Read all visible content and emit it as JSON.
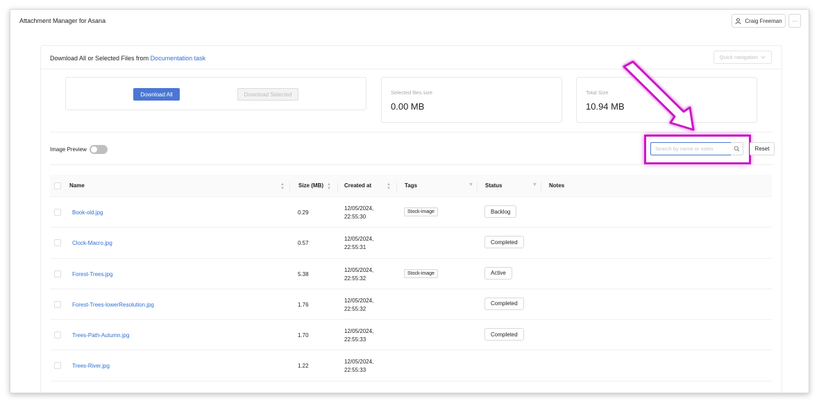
{
  "app": {
    "title": "Attachment Manager for Asana",
    "user_name": "Craig Freeman",
    "more_label": "···"
  },
  "card": {
    "title_prefix": "Download All or Selected Files from ",
    "task_link": "Documentation task",
    "quick_nav_label": "Quick navigation"
  },
  "downloads": {
    "download_all_label": "Download All",
    "download_selected_label": "Download Selected"
  },
  "stats": {
    "selected_label": "Selected files size",
    "selected_value": "0.00 MB",
    "total_label": "Total Size",
    "total_value": "10.94 MB"
  },
  "controls": {
    "image_preview_label": "Image Preview",
    "image_preview_on": false,
    "search_placeholder": "Search by name or notes",
    "reset_label": "Reset"
  },
  "colors": {
    "primary": "#4a77d4",
    "link": "#2f6fd6",
    "highlight": "#cc17c8"
  },
  "table": {
    "headers": {
      "name": "Name",
      "size": "Size (MB)",
      "created": "Created at",
      "tags": "Tags",
      "status": "Status",
      "notes": "Notes"
    },
    "rows": [
      {
        "name": "Book-old.jpg",
        "size": "0.29",
        "date": "12/05/2024,",
        "time": "22:55:30",
        "tag": "Stock-image",
        "status": "Backlog"
      },
      {
        "name": "Clock-Macro.jpg",
        "size": "0.57",
        "date": "12/05/2024,",
        "time": "22:55:31",
        "tag": "",
        "status": "Completed"
      },
      {
        "name": "Forest-Trees.jpg",
        "size": "5.38",
        "date": "12/05/2024,",
        "time": "22:55:32",
        "tag": "Stock-image",
        "status": "Active"
      },
      {
        "name": "Forest-Trees-lowerResolution.jpg",
        "size": "1.76",
        "date": "12/05/2024,",
        "time": "22:55:32",
        "tag": "",
        "status": "Completed"
      },
      {
        "name": "Trees-Path-Autumn.jpg",
        "size": "1.70",
        "date": "12/05/2024,",
        "time": "22:55:33",
        "tag": "",
        "status": "Completed"
      },
      {
        "name": "Trees-River.jpg",
        "size": "1.22",
        "date": "12/05/2024,",
        "time": "22:55:33",
        "tag": "",
        "status": ""
      }
    ]
  }
}
